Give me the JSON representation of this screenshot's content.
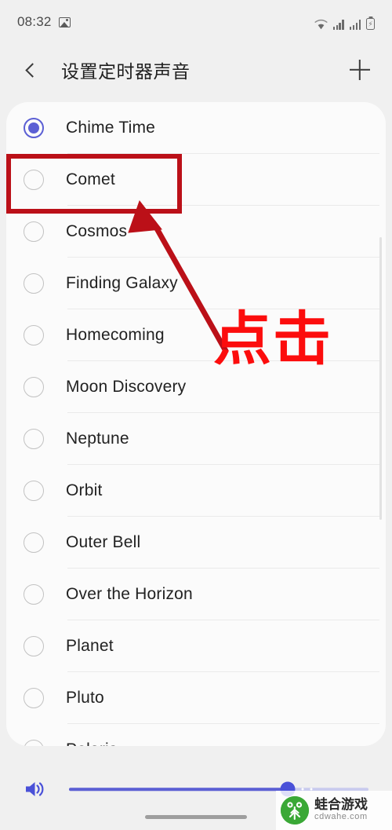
{
  "status_bar": {
    "time": "08:32",
    "photo_icon": "image-icon",
    "wifi_icon": "wifi-icon",
    "signal_icon_1": "signal-bars-icon",
    "signal_icon_2": "signal-bars-icon",
    "battery_icon": "battery-charging-icon",
    "battery_glyph": "⚡"
  },
  "app_bar": {
    "back_icon": "back-chevron-icon",
    "title": "设置定时器声音",
    "add_icon": "plus-icon"
  },
  "sound_list": {
    "selected": "Chime Time",
    "items": [
      {
        "label": "Chime Time",
        "selected": true
      },
      {
        "label": "Comet",
        "selected": false
      },
      {
        "label": "Cosmos",
        "selected": false
      },
      {
        "label": "Finding Galaxy",
        "selected": false
      },
      {
        "label": "Homecoming",
        "selected": false
      },
      {
        "label": "Moon Discovery",
        "selected": false
      },
      {
        "label": "Neptune",
        "selected": false
      },
      {
        "label": "Orbit",
        "selected": false
      },
      {
        "label": "Outer Bell",
        "selected": false
      },
      {
        "label": "Over the Horizon",
        "selected": false
      },
      {
        "label": "Planet",
        "selected": false
      },
      {
        "label": "Pluto",
        "selected": false
      },
      {
        "label": "Polaris",
        "selected": false
      }
    ]
  },
  "volume": {
    "icon": "speaker-volume-icon",
    "value_percent": 73
  },
  "annotations": {
    "highlight_target": "Comet",
    "callout_text": "点击",
    "box_color": "#bb1018",
    "text_color": "#fc0d0d",
    "arrow_icon": "arrow-pointer-icon"
  },
  "watermark": {
    "logo_icon": "frog-logo-icon",
    "title": "蛙合游戏",
    "url": "cdwahe.com"
  },
  "theme": {
    "accent": "#5b5fd4",
    "page_bg": "#f0f0f0",
    "card_bg": "#fbfbfb"
  },
  "gesture_bar": "home-indicator"
}
